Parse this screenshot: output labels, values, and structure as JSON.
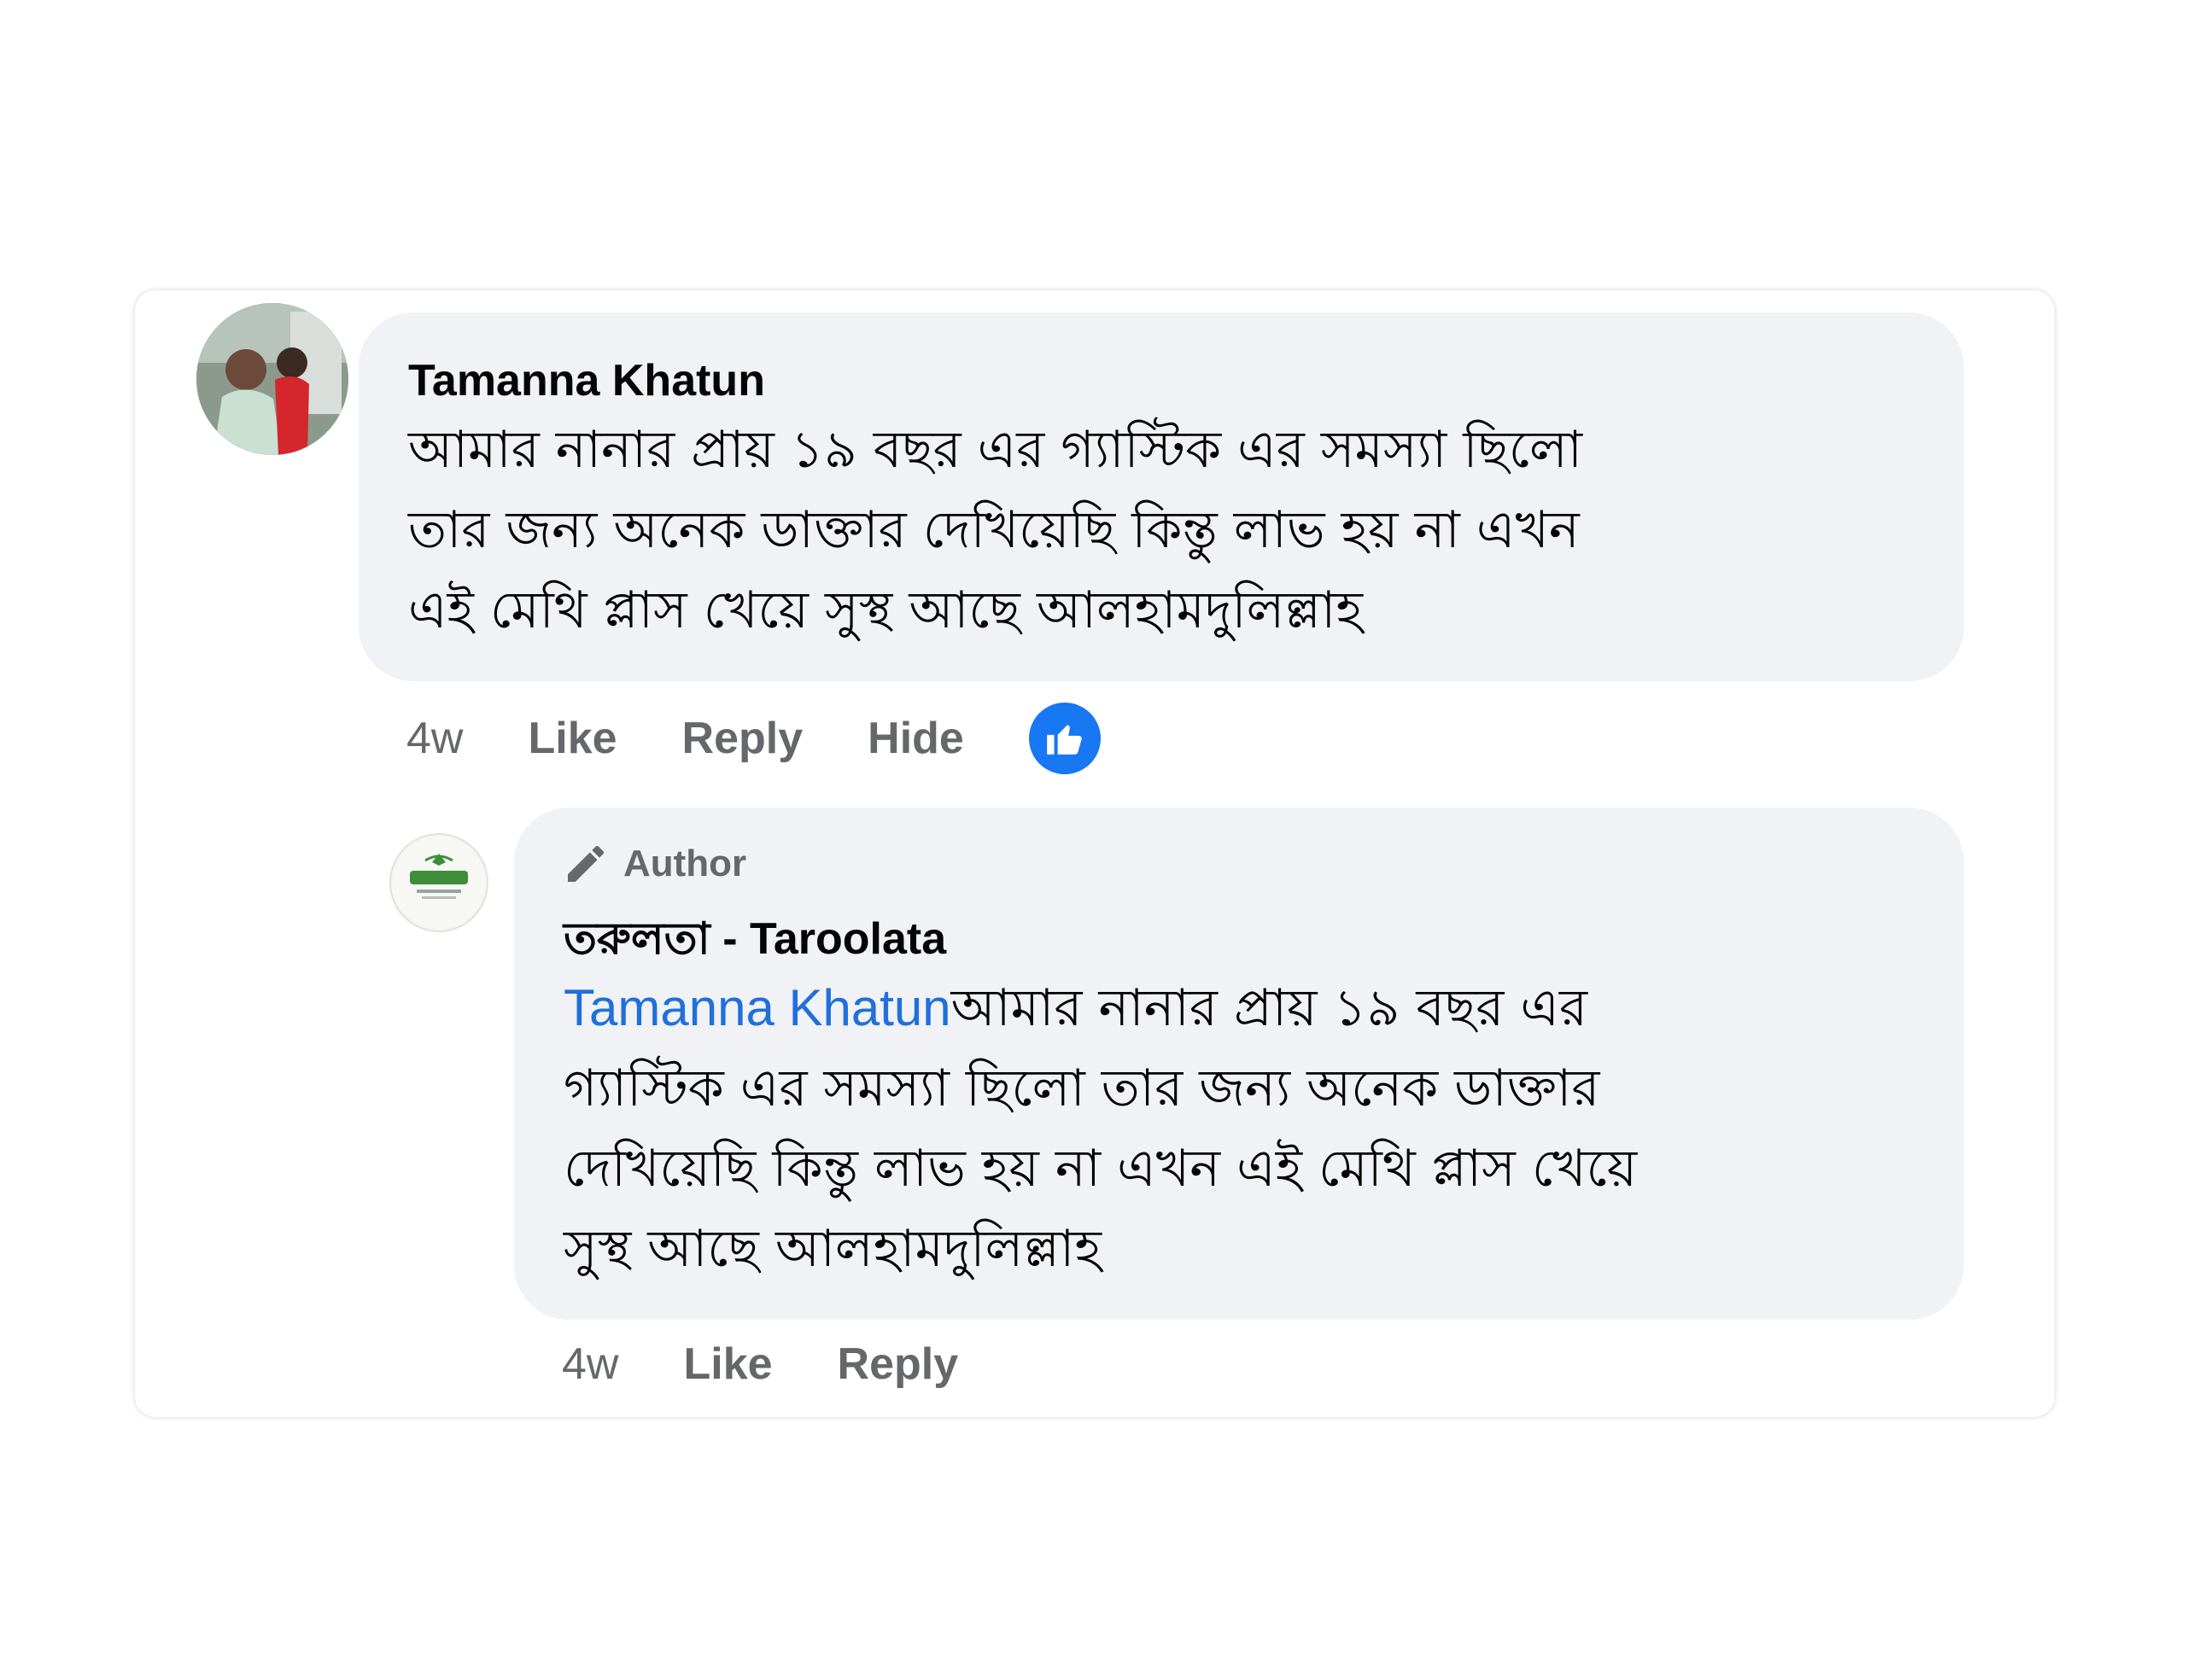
{
  "comment": {
    "author": "Tamanna Khatun",
    "lines": [
      "আমার নানার প্রায় ১৯ বছর এর গ্যাস্টিক এর সমস্যা ছিলো",
      "তার জন্য অনেক ডাক্তার দেখিয়েছি কিন্তু লাভ হয় না এখন",
      "এই মেথি প্লাস খেয়ে সুস্থ আছে আলহামদুলিল্লাহ"
    ],
    "time": "4w",
    "like_label": "Like",
    "reply_label": "Reply",
    "hide_label": "Hide"
  },
  "reply": {
    "badge_label": "Author",
    "author": "তরুলতা - Taroolata",
    "mention": "Tamanna Khatun",
    "lines": [
      "আমার নানার প্রায় ১৯ বছর এর",
      "গ্যাস্টিক এর সমস্যা ছিলো তার জন্য অনেক ডাক্তার",
      "দেখিয়েছি কিন্তু লাভ হয় না এখন এই মেথি প্লাস খেয়ে",
      "সুস্থ আছে আলহামদুলিল্লাহ"
    ],
    "time": "4w",
    "like_label": "Like",
    "reply_label": "Reply"
  },
  "colors": {
    "bubble": "#f0f2f5",
    "mention": "#216fdb",
    "meta": "#65676b",
    "like_badge": "#1877f2"
  }
}
